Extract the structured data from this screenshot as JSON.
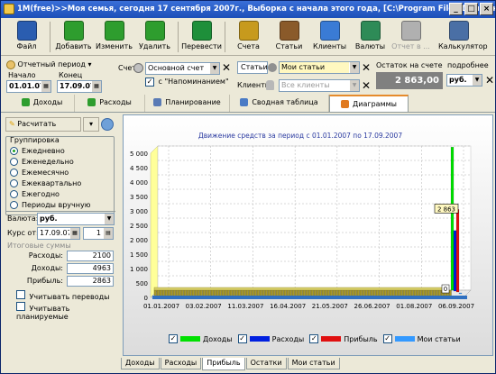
{
  "window": {
    "title": "1M(free)>>Моя семья, сегодня 17 сентября 2007г., Выборка с начала этого года, [C:\\Program Files\\Домашние финансы\\..."
  },
  "toolbar": {
    "items": [
      {
        "label": "Файл",
        "icon": "file-icon",
        "color": "#2a5db0"
      },
      {
        "label": "Добавить",
        "icon": "add-icon",
        "color": "#2e9d2e"
      },
      {
        "label": "Изменить",
        "icon": "edit-icon",
        "color": "#2e9d2e"
      },
      {
        "label": "Удалить",
        "icon": "delete-icon",
        "color": "#2e9d2e"
      },
      {
        "label": "Перевести",
        "icon": "transfer-icon",
        "color": "#1e8f3a"
      },
      {
        "label": "Счета",
        "icon": "accounts-icon",
        "color": "#c79a1d"
      },
      {
        "label": "Статьи",
        "icon": "categories-icon",
        "color": "#8a5a2a"
      },
      {
        "label": "Клиенты",
        "icon": "clients-icon",
        "color": "#3a7bd5"
      },
      {
        "label": "Валюты",
        "icon": "currency-icon",
        "color": "#2e8b57"
      },
      {
        "label": "Отчет в ...",
        "icon": "report-icon",
        "color": "#b0b0b0",
        "disabled": true
      },
      {
        "label": "Калькулятор",
        "icon": "calculator-icon",
        "color": "#4a6fa5"
      }
    ]
  },
  "filters": {
    "period_button": "Отчетный период",
    "start_label": "Начало",
    "end_label": "Конец",
    "start_value": "01.01.07",
    "end_value": "17.09.07",
    "account_label": "Счет",
    "account_value": "Основной счет",
    "reminders_label": "с \"Напоминанием\"",
    "reminders_checked": "✓",
    "categories_label": "Статьи",
    "categories_value": "Мои статьи",
    "clients_label": "Клиенты",
    "clients_value": "Все клиенты",
    "balance_label": "Остаток на счете",
    "balance_value": "2 863,00",
    "currency_value": "руб.",
    "more_label": "подробнее"
  },
  "tabs": [
    {
      "label": "Доходы",
      "color": "#2e9d2e"
    },
    {
      "label": "Расходы",
      "color": "#2e9d2e"
    },
    {
      "label": "Планирование",
      "color": "#5a7bb5"
    },
    {
      "label": "Сводная таблица",
      "color": "#4a7bc5"
    },
    {
      "label": "Диаграммы",
      "color": "#e07a20",
      "active": true
    }
  ],
  "left": {
    "calc_button": "Расчитать",
    "group_title": "Группировка",
    "grouping": [
      {
        "label": "Ежедневно",
        "selected": true
      },
      {
        "label": "Еженедельно",
        "selected": false
      },
      {
        "label": "Ежемесячно",
        "selected": false
      },
      {
        "label": "Ежеквартально",
        "selected": false
      },
      {
        "label": "Ежегодно",
        "selected": false
      },
      {
        "label": "Периоды вручную",
        "selected": false
      }
    ],
    "currency_label": "Валюта:",
    "currency_value": "руб.",
    "rate_label": "Курс от:",
    "rate_date": "17.09.07",
    "rate_value": "1",
    "totals_title": "Итоговые суммы",
    "expenses_label": "Расходы:",
    "expenses_value": "2100",
    "income_label": "Доходы:",
    "income_value": "4963",
    "profit_label": "Прибыль:",
    "profit_value": "2863",
    "transfers_label": "Учитывать переводы",
    "planned_label": "Учитывать планируемые"
  },
  "chart_data": {
    "type": "bar",
    "title": "Движение средств за период с 01.01.2007 по 17.09.2007",
    "categories": [
      "01.01.2007",
      "03.02.2007",
      "11.03.2007",
      "16.04.2007",
      "21.05.2007",
      "26.06.2007",
      "01.08.2007",
      "06.09.2007"
    ],
    "ylim": [
      0,
      5000
    ],
    "yticks": [
      "0",
      "500",
      "1 000",
      "1 500",
      "2 000",
      "2 500",
      "3 000",
      "3 500",
      "4 000",
      "4 500",
      "5 000"
    ],
    "grid": true,
    "series": [
      {
        "name": "Доходы",
        "color": "#00e000",
        "last_value": 4963
      },
      {
        "name": "Расходы",
        "color": "#0020e0",
        "last_value": 2100
      },
      {
        "name": "Прибыль",
        "color": "#e01010",
        "last_value": 2863
      },
      {
        "name": "Мои статьи",
        "color": "#3399ff",
        "last_value": 0
      }
    ],
    "annotations": [
      "2 863",
      "0"
    ],
    "legend_position": "bottom"
  },
  "bottom_tabs": [
    {
      "label": "Доходы"
    },
    {
      "label": "Расходы"
    },
    {
      "label": "Прибыль",
      "active": true
    },
    {
      "label": "Остатки"
    },
    {
      "label": "Мои статьи"
    }
  ]
}
